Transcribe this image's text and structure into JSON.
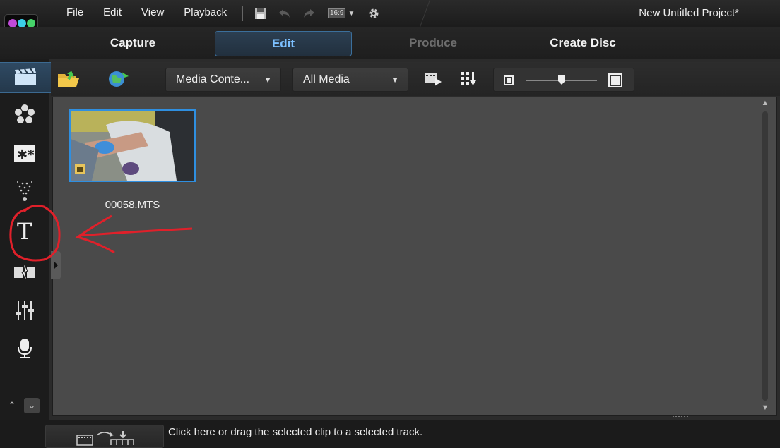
{
  "menu": {
    "items": [
      "File",
      "Edit",
      "View",
      "Playback"
    ],
    "aspect_ratio": "16:9",
    "project_title": "New Untitled Project*"
  },
  "modes": {
    "capture": "Capture",
    "edit": "Edit",
    "produce": "Produce",
    "create_disc": "Create Disc",
    "active": "Edit"
  },
  "library": {
    "content_dropdown": "Media Conte...",
    "filter_dropdown": "All Media",
    "clip": {
      "filename": "00058.MTS"
    }
  },
  "status": {
    "hint": "Click here or drag the selected clip to a selected track."
  },
  "colors": {
    "accent": "#2f8fe0",
    "active_tab_text": "#7cc0ff",
    "library_bg": "#4a4a4a",
    "annotation": "#e0202a"
  },
  "icons": {
    "left_rail": [
      "media-room-icon",
      "fx-room-icon",
      "pip-object-icon",
      "particle-icon",
      "title-icon",
      "transition-icon",
      "audio-mixer-icon",
      "voiceover-icon"
    ],
    "library_toolbar": [
      "import-media-icon",
      "download-media-icon",
      "add-to-track-icon",
      "grid-view-icon",
      "thumbnail-small-icon",
      "thumbnail-large-icon"
    ]
  }
}
